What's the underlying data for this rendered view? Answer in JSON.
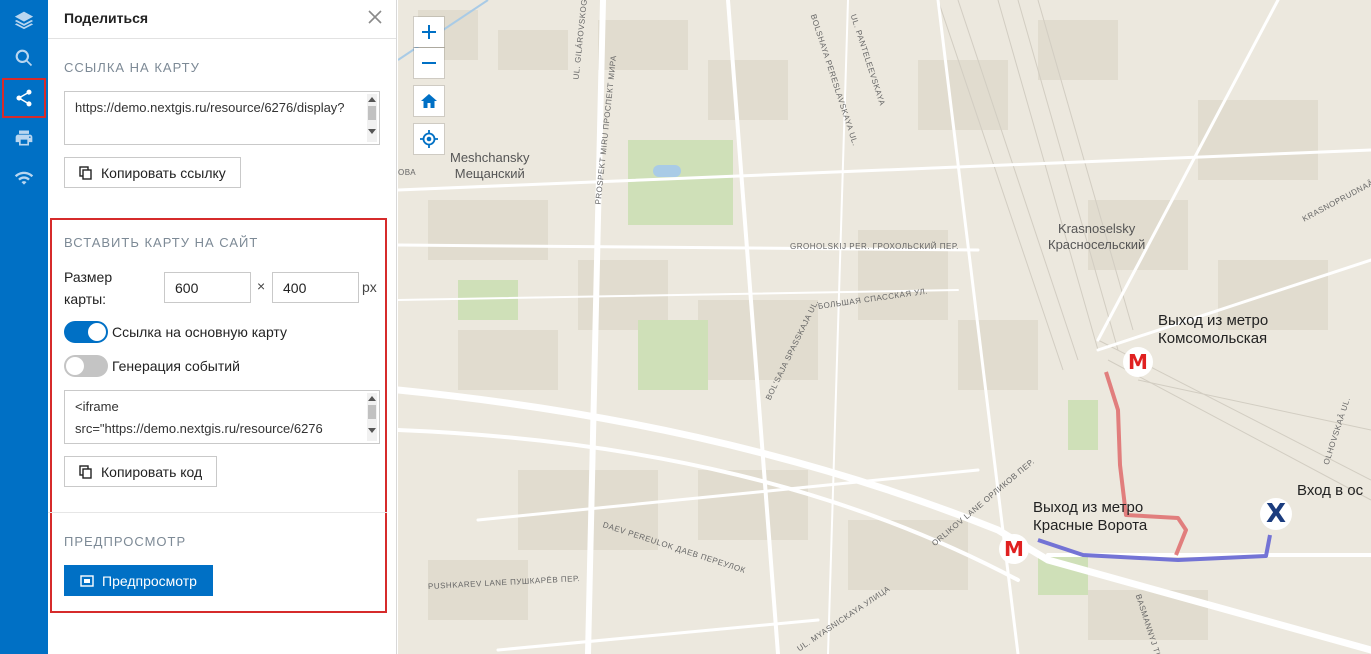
{
  "rail": {
    "items": [
      {
        "icon": "layers-icon",
        "active": false
      },
      {
        "icon": "search-icon",
        "active": false
      },
      {
        "icon": "share-icon",
        "active": true
      },
      {
        "icon": "print-icon",
        "active": false
      },
      {
        "icon": "wifi-icon",
        "active": false
      }
    ],
    "accent": "#0070c5"
  },
  "panel": {
    "title": "Поделиться",
    "link": {
      "section_title": "ССЫЛКА НА КАРТУ",
      "url_value": "https://demo.nextgis.ru/resource/6276/display?",
      "copy_label": "Копировать ссылку"
    },
    "embed": {
      "section_title": "ВСТАВИТЬ КАРТУ НА САЙТ",
      "size_label": "Размер карты:",
      "width": "600",
      "times": "×",
      "height": "400",
      "unit": "px",
      "toggle_main_link": {
        "label": "Ссылка на основную карту",
        "on": true
      },
      "toggle_events": {
        "label": "Генерация событий",
        "on": false
      },
      "code_value": "<iframe src=\"https://demo.nextgis.ru/resource/6276",
      "copy_code_label": "Копировать код"
    },
    "preview": {
      "section_title": "ПРЕДПРОСМОТР",
      "button_label": "Предпросмотр"
    }
  },
  "map": {
    "controls": [
      "zoom-in",
      "zoom-out",
      "home",
      "locate"
    ],
    "district_labels": [
      {
        "latin": "Meshchansky",
        "cyrillic": "Мещанский"
      },
      {
        "latin": "Krasnoselsky",
        "cyrillic": "Красносельский"
      }
    ],
    "streets": [
      "UL. GILÁROVSKOGO",
      "PROSPEKT MIRU ПРОСПЕКТ МИРА",
      "BOLSHAYA PERESLAVSKAYA UL.",
      "UL. PANTELEEVSKAYA",
      "GROHOLSKIJ PER. ГРОХОЛЬСКИЙ ПЕР.",
      "БОЛЬШАЯ СПАССКАЯ УЛ.",
      "BOL'SAJA SPASSKAJA UL.",
      "ORLIKOV LANE ОРЛИКОВ ПЕР.",
      "DAEV PEREULOK ДАЕВ ПЕРЕУЛОК",
      "PUSHKAREV LANE ПУШКАРЁВ ПЕР.",
      "UL. MYASNICKAYA УЛИЦА",
      "BASMANNYJ TUP.",
      "KRASNOPRUDNAÂ UL.",
      "OLHOVSKAÂ UL.",
      "ОВА"
    ],
    "pois": [
      {
        "label_line1": "Выход из метро",
        "label_line2": "Комсомольская"
      },
      {
        "label_line1": "Выход из метро",
        "label_line2": "Красные Ворота"
      },
      {
        "label_line1": "Вход в ос",
        "label_line2": ""
      }
    ],
    "metro_symbol": "М",
    "x_symbol": "X",
    "route_colors": {
      "red": "#e07272",
      "blue": "#6d6dd4"
    }
  }
}
